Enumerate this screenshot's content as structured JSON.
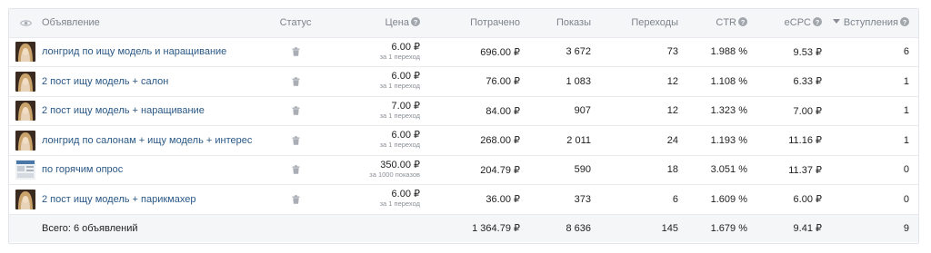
{
  "header": {
    "ad": "Объявление",
    "status": "Статус",
    "price": "Цена",
    "spent": "Потрачено",
    "impressions": "Показы",
    "clicks": "Переходы",
    "ctr": "CTR",
    "ecpc": "eCPC",
    "joins": "Вступления"
  },
  "rows": [
    {
      "name": "лонгрид по ищу модель и наращивание",
      "thumb": "portrait",
      "price": "6.00 ₽",
      "price_unit": "за 1 переход",
      "spent": "696.00 ₽",
      "impressions": "3 672",
      "clicks": "73",
      "ctr": "1.988 %",
      "ecpc": "9.53 ₽",
      "joins": "6"
    },
    {
      "name": "2 пост ищу модель + салон",
      "thumb": "portrait",
      "price": "6.00 ₽",
      "price_unit": "за 1 переход",
      "spent": "76.00 ₽",
      "impressions": "1 083",
      "clicks": "12",
      "ctr": "1.108 %",
      "ecpc": "6.33 ₽",
      "joins": "1"
    },
    {
      "name": "2 пост ищу модель + наращивание",
      "thumb": "portrait",
      "price": "7.00 ₽",
      "price_unit": "за 1 переход",
      "spent": "84.00 ₽",
      "impressions": "907",
      "clicks": "12",
      "ctr": "1.323 %",
      "ecpc": "7.00 ₽",
      "joins": "1"
    },
    {
      "name": "лонгрид по салонам + ищу модель + интерес",
      "thumb": "portrait",
      "price": "6.00 ₽",
      "price_unit": "за 1 переход",
      "spent": "268.00 ₽",
      "impressions": "2 011",
      "clicks": "24",
      "ctr": "1.193 %",
      "ecpc": "11.16 ₽",
      "joins": "1"
    },
    {
      "name": "по горячим опрос",
      "thumb": "screen",
      "price": "350.00 ₽",
      "price_unit": "за 1000 показов",
      "spent": "204.79 ₽",
      "impressions": "590",
      "clicks": "18",
      "ctr": "3.051 %",
      "ecpc": "11.37 ₽",
      "joins": "0"
    },
    {
      "name": "2 пост ищу модель + парикмахер",
      "thumb": "portrait",
      "price": "6.00 ₽",
      "price_unit": "за 1 переход",
      "spent": "36.00 ₽",
      "impressions": "373",
      "clicks": "6",
      "ctr": "1.609 %",
      "ecpc": "6.00 ₽",
      "joins": "0"
    }
  ],
  "total": {
    "label": "Всего: 6 объявлений",
    "spent": "1 364.79 ₽",
    "impressions": "8 636",
    "clicks": "145",
    "ctr": "1.679 %",
    "ecpc": "9.41 ₽",
    "joins": "9"
  },
  "icons": {
    "header_visibility": "eye-icon",
    "info": "info-icon",
    "sort": "sort-desc-icon",
    "status": "trash-icon",
    "thumb_portrait": "portrait-thumbnail",
    "thumb_screen": "screenshot-thumbnail"
  },
  "colors": {
    "link": "#2a5885",
    "header_bg": "#f5f6f8",
    "border": "#e3e5ea",
    "muted": "#7d838c"
  }
}
